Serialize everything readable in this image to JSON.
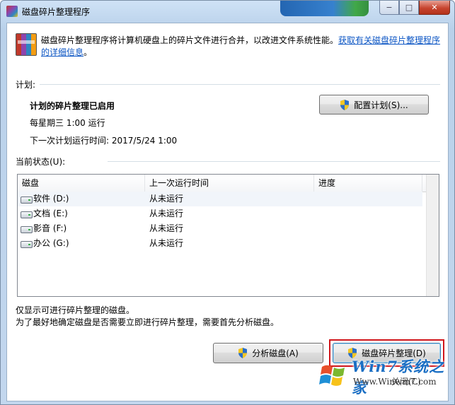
{
  "window": {
    "title": "磁盘碎片整理程序",
    "buttons": {
      "minimize": "−",
      "maximize": "□",
      "close": "✕"
    }
  },
  "header": {
    "intro": "磁盘碎片整理程序将计算机硬盘上的碎片文件进行合并，以改进文件系统性能。",
    "link": "获取有关磁盘碎片整理程序的详细信息",
    "link_suffix": "。"
  },
  "schedule": {
    "section_label": "计划:",
    "status": "计划的碎片整理已启用",
    "frequency": "每星期三  1:00 运行",
    "next_run": "下一次计划运行时间: 2017/5/24 1:00",
    "configure_button": "配置计划(S)..."
  },
  "current_status": {
    "section_label": "当前状态(U):",
    "columns": [
      "磁盘",
      "上一次运行时间",
      "进度"
    ],
    "rows": [
      {
        "disk": "软件 (D:)",
        "last_run": "从未运行",
        "progress": ""
      },
      {
        "disk": "文档 (E:)",
        "last_run": "从未运行",
        "progress": ""
      },
      {
        "disk": "影音 (F:)",
        "last_run": "从未运行",
        "progress": ""
      },
      {
        "disk": "办公 (G:)",
        "last_run": "从未运行",
        "progress": ""
      }
    ]
  },
  "footer": {
    "note1": "仅显示可进行碎片整理的磁盘。",
    "note2": "为了最好地确定磁盘是否需要立即进行碎片整理，需要首先分析磁盘。",
    "analyze_button": "分析磁盘(A)",
    "defrag_button": "磁盘碎片整理(D)",
    "close_button": "关闭(C)"
  },
  "watermark": {
    "brand": "Win7系统之家",
    "url": "Www.Winwin7.com"
  },
  "colors": {
    "highlight": "#d0161b",
    "link": "#0b55c4",
    "window_frame": "#b9d1ea"
  },
  "icons": [
    "defrag-app-icon",
    "uac-shield-icon",
    "drive-icon",
    "windows-logo-icon"
  ]
}
